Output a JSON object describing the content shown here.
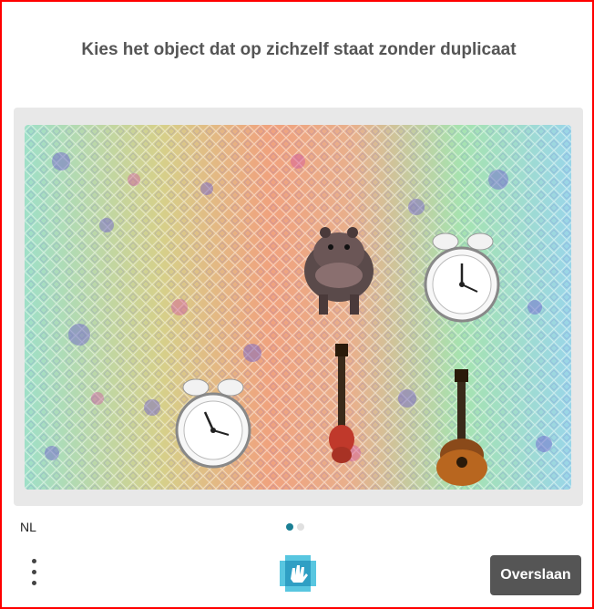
{
  "prompt": "Kies het object dat op zichzelf staat zonder duplicaat",
  "language": "NL",
  "pagination": {
    "total": 2,
    "current": 1,
    "active_color": "#1a7f94",
    "inactive_color": "#e0e0e0"
  },
  "skip_label": "Overslaan",
  "objects": [
    {
      "id": "hippo",
      "icon": "hippo-icon",
      "count": 1
    },
    {
      "id": "clock",
      "icon": "alarm-clock-icon",
      "count": 2
    },
    {
      "id": "guitar",
      "icon": "guitar-icon",
      "count": 2
    }
  ]
}
